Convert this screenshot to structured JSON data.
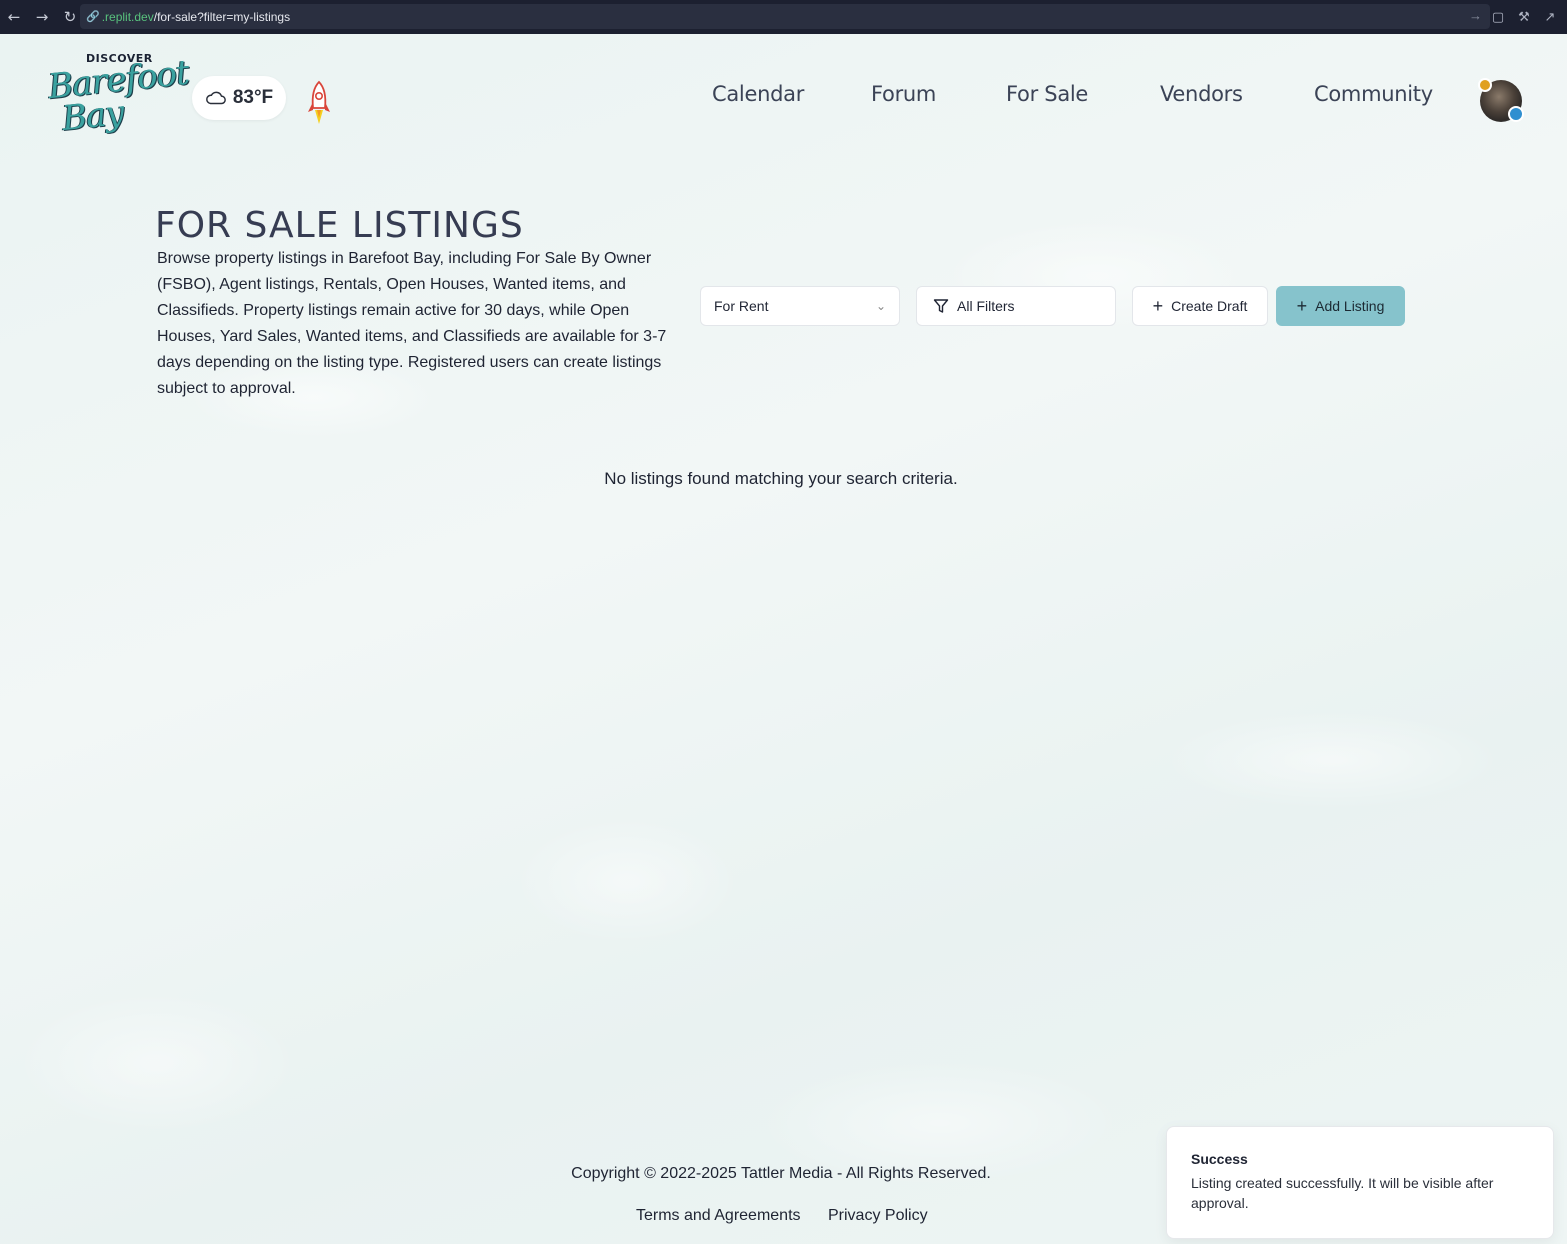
{
  "browser": {
    "url_host": ".replit.dev",
    "url_path": "/for-sale?filter=my-listings"
  },
  "header": {
    "logo_top": "DISCOVER",
    "logo_line1": "Barefoot",
    "logo_line2": "Bay",
    "weather_temp": "83°F",
    "nav": [
      "Calendar",
      "Forum",
      "For Sale",
      "Vendors",
      "Community"
    ]
  },
  "main": {
    "title": "FOR SALE LISTINGS",
    "description": "Browse property listings in Barefoot Bay, including For Sale By Owner (FSBO), Agent listings, Rentals, Open Houses, Wanted items, and Classifieds. Property listings remain active for 30 days, while Open Houses, Yard Sales, Wanted items, and Classifieds are available for 3-7 days depending on the listing type. Registered users can create listings subject to approval.",
    "type_select": "For Rent",
    "filters_label": "All Filters",
    "create_draft_label": "Create Draft",
    "add_listing_label": "Add Listing",
    "empty_message": "No listings found matching your search criteria."
  },
  "footer": {
    "copyright": "Copyright © 2022-2025 Tattler Media - All Rights Reserved.",
    "terms": "Terms and Agreements",
    "privacy": "Privacy Policy"
  },
  "toast": {
    "title": "Success",
    "message": "Listing created successfully. It will be visible after approval."
  },
  "colors": {
    "accent_button": "#86c3cc",
    "logo_teal": "#3aa19f",
    "title_text": "#363c52"
  }
}
